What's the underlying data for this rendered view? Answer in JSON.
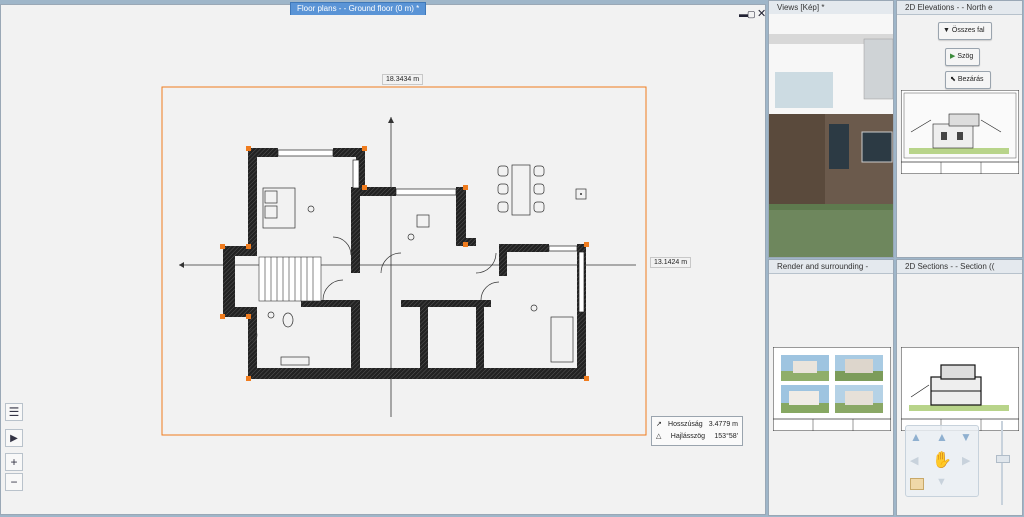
{
  "main_tab": {
    "label": "Floor plans -  - Ground floor (0 m) *"
  },
  "dims": {
    "width": "18.3434 m",
    "height": "13.1424 m"
  },
  "info": {
    "length_label": "Hosszúság",
    "length_value": "3.4779 m",
    "angle_label": "Hajlásszög",
    "angle_value": "153°58'"
  },
  "thumbs": {
    "views": "Views [Kép] *",
    "elevations": "2D Elevations -  - North e",
    "render": "Render and surrounding -",
    "sections": "2D Sections -  - Section (("
  },
  "elev_buttons": {
    "all_walls": "Összes fal",
    "angle": "Szög",
    "close": "Bezárás"
  },
  "sidebar": {
    "list_icon": "list-icon",
    "play_icon": "play-icon",
    "zoom_in": "+",
    "zoom_out": "−"
  },
  "colors": {
    "accent": "#5a94d6",
    "selection": "#f07c1e",
    "wall": "#1a1a1a"
  }
}
